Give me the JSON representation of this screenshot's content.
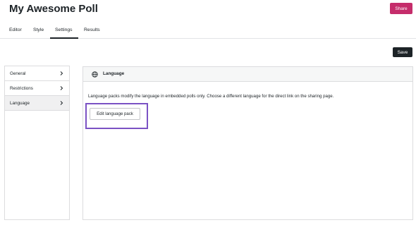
{
  "header": {
    "title": "My Awesome Poll",
    "share_label": "Share"
  },
  "tabs": [
    {
      "label": "Editor",
      "active": false
    },
    {
      "label": "Style",
      "active": false
    },
    {
      "label": "Settings",
      "active": true
    },
    {
      "label": "Results",
      "active": false
    }
  ],
  "toolbar": {
    "save_label": "Save"
  },
  "sidebar": {
    "items": [
      {
        "label": "General",
        "icon": "chevron-right-icon",
        "active": false
      },
      {
        "label": "Restrictions",
        "icon": "chevron-right-icon",
        "active": false
      },
      {
        "label": "Language",
        "icon": "chevron-right-icon",
        "active": true
      }
    ]
  },
  "panel": {
    "icon": "globe-icon",
    "title": "Language",
    "description": "Language packs modify the language in embedded polls only. Choose a different language for the direct link on the sharing page.",
    "edit_button_label": "Edit language pack"
  },
  "colors": {
    "share_button": "#c52d6b",
    "save_button": "#1d2327",
    "highlight_border": "#7b52c4"
  }
}
